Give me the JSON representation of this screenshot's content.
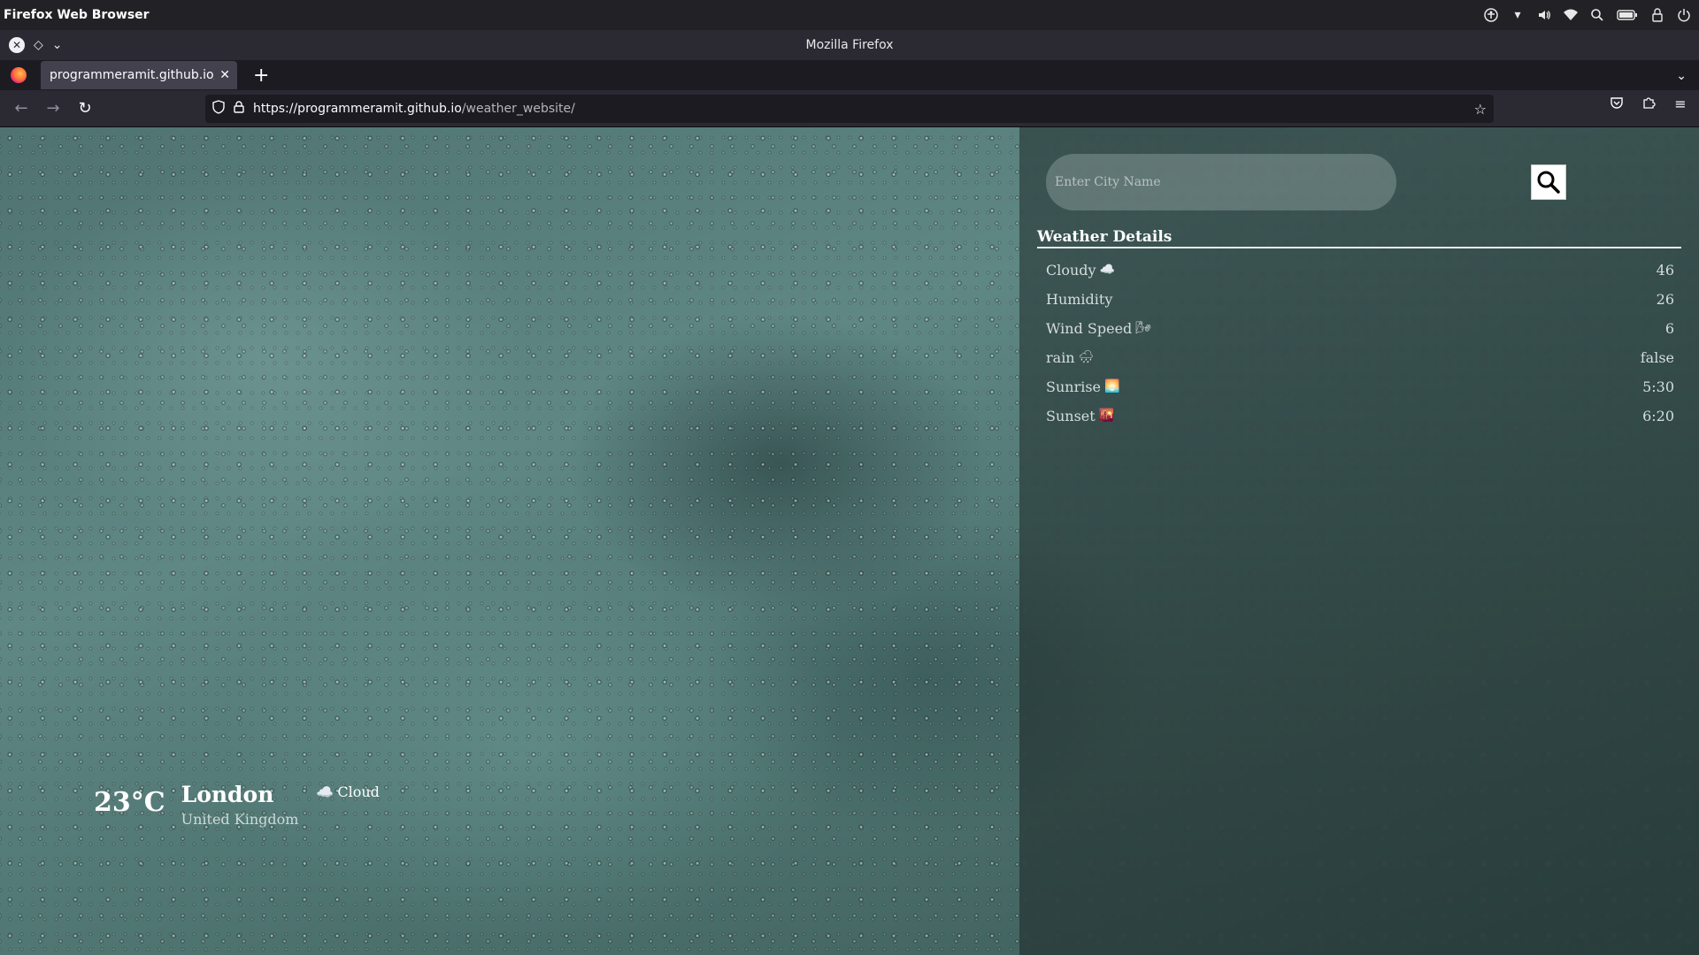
{
  "os": {
    "title": "Firefox Web Browser"
  },
  "window": {
    "title": "Mozilla Firefox"
  },
  "tabs": [
    {
      "label": "programmeramit.github.io/weather_website/",
      "active": true
    }
  ],
  "nav": {
    "url_host": "https://programmeramit.github.io",
    "url_path": "/weather_website/"
  },
  "search": {
    "placeholder": "Enter City Name"
  },
  "details": {
    "title": "Weather Details",
    "rows": [
      {
        "label": "Cloudy",
        "icon": "cloud-icon",
        "emoji": "☁️",
        "value": "46"
      },
      {
        "label": "Humidity",
        "icon": "",
        "emoji": "",
        "value": "26"
      },
      {
        "label": "Wind Speed",
        "icon": "wind-icon",
        "emoji": "🌬",
        "value": "6"
      },
      {
        "label": "rain",
        "icon": "rain-cloud-icon",
        "emoji": "🌧",
        "value": "false"
      },
      {
        "label": "Sunrise",
        "icon": "sunrise-icon",
        "emoji": "🌅",
        "value": "5:30"
      },
      {
        "label": "Sunset",
        "icon": "sunset-icon",
        "emoji": "🌇",
        "value": "6:20"
      }
    ]
  },
  "current": {
    "temperature": "23°C",
    "city": "London",
    "country": "United Kingdom",
    "condition": "Cloud",
    "condition_icon": "cloud-icon",
    "condition_emoji": "☁️"
  },
  "colors": {
    "panel_overlay": "#141e1e",
    "text_primary": "#ffffff",
    "browser_chrome": "#2b2a33"
  }
}
